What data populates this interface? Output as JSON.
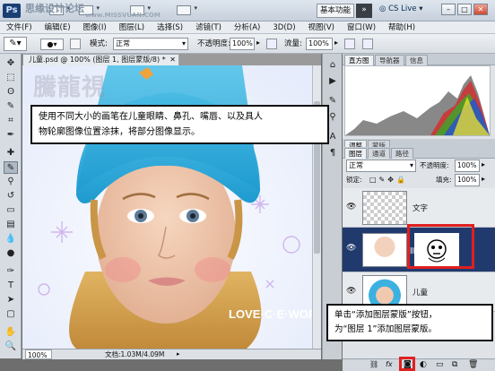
{
  "watermark_top": "思缘设计论坛",
  "watermark_url": "www.MISSVUAN.COM",
  "watermark_canvas": "騰龍視 WWW.TLVI.NET",
  "workspace": "基本功能",
  "cs_live": "CS Live",
  "menu": [
    "文件(F)",
    "编辑(E)",
    "图像(I)",
    "图层(L)",
    "选择(S)",
    "滤镜(T)",
    "分析(A)",
    "3D(D)",
    "视图(V)",
    "窗口(W)",
    "帮助(H)"
  ],
  "options": {
    "mode_label": "模式:",
    "mode_value": "正常",
    "opacity_label": "不透明度:",
    "opacity_value": "100%",
    "flow_label": "流量:",
    "flow_value": "100%"
  },
  "document": {
    "tab": "儿童.psd @ 100% (图层 1, 图层蒙版/8) *",
    "zoom": "100%",
    "doc_info": "文档:1.03M/4.09M"
  },
  "callouts": {
    "top": [
      "使用不同大小的画笔在儿童眼睛、鼻孔、嘴唇、以及具人",
      "物轮廓图像位置涂抹，将部分图像显示。"
    ],
    "bottom": [
      "单击“添加图层蒙版”按钮，",
      "为“图层 1”添加图层蒙版。"
    ]
  },
  "histogram_tabs": [
    "直方图",
    "导航器",
    "信息"
  ],
  "layers_tabs": [
    "调整",
    "蒙版"
  ],
  "layers_tabs2": [
    "图层",
    "通道",
    "路径"
  ],
  "layers": {
    "blend_mode": "正常",
    "opacity_label": "不透明度:",
    "opacity_value": "100%",
    "lock_label": "锁定:",
    "fill_label": "填充:",
    "fill_value": "100%",
    "items": [
      {
        "name": "文字",
        "kind": "text"
      },
      {
        "name": "",
        "kind": "masked",
        "selected": true
      },
      {
        "name": "儿童",
        "kind": "photo"
      }
    ]
  },
  "canvas_text": "LOVE·C·E·WORLD",
  "colors": {
    "accent": "#e02020",
    "selected_layer": "#213a6e"
  }
}
